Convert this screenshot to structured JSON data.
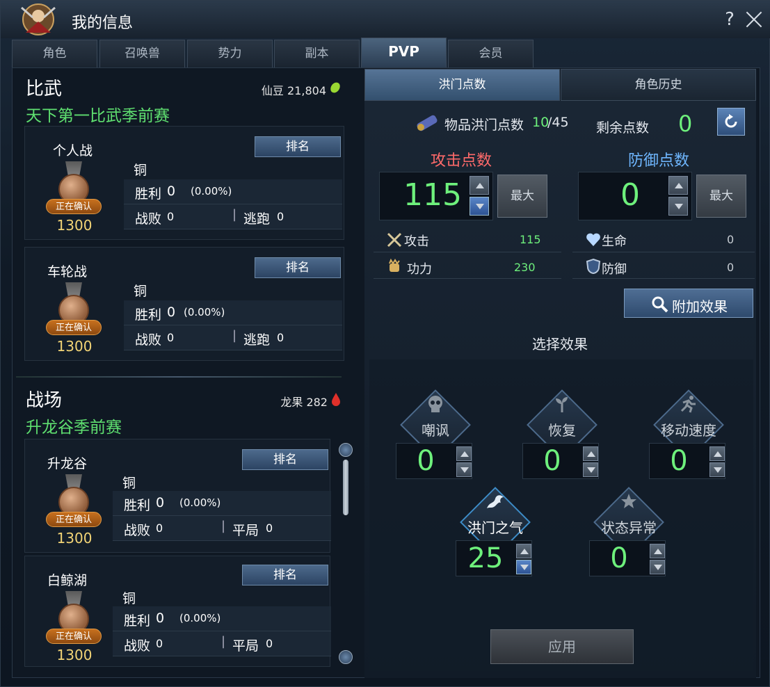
{
  "window": {
    "title": "我的信息",
    "help": "?"
  },
  "tabs": [
    "角色",
    "召唤兽",
    "势力",
    "副本",
    "PVP",
    "会员"
  ],
  "left": {
    "biwu": {
      "title": "比武",
      "season": "天下第一比武季前赛",
      "currency_label": "仙豆 21,804",
      "cards": [
        {
          "mode": "个人战",
          "rank_btn": "排名",
          "tier": "铜",
          "badge": "正在确认",
          "score": "1300",
          "win_label": "胜利",
          "win": "0",
          "win_pct": "(0.00%)",
          "lose_label": "战败",
          "lose": "0",
          "extra_label": "逃跑",
          "extra": "0"
        },
        {
          "mode": "车轮战",
          "rank_btn": "排名",
          "tier": "铜",
          "badge": "正在确认",
          "score": "1300",
          "win_label": "胜利",
          "win": "0",
          "win_pct": "(0.00%)",
          "lose_label": "战败",
          "lose": "0",
          "extra_label": "逃跑",
          "extra": "0"
        }
      ]
    },
    "battlefield": {
      "title": "战场",
      "season": "升龙谷季前赛",
      "currency_label": "龙果 282",
      "cards": [
        {
          "mode": "升龙谷",
          "rank_btn": "排名",
          "tier": "铜",
          "badge": "正在确认",
          "score": "1300",
          "win_label": "胜利",
          "win": "0",
          "win_pct": "(0.00%)",
          "lose_label": "战败",
          "lose": "0",
          "extra_label": "平局",
          "extra": "0"
        },
        {
          "mode": "白鲸湖",
          "rank_btn": "排名",
          "tier": "铜",
          "badge": "正在确认",
          "score": "1300",
          "win_label": "胜利",
          "win": "0",
          "win_pct": "(0.00%)",
          "lose_label": "战败",
          "lose": "0",
          "extra_label": "平局",
          "extra": "0"
        }
      ]
    }
  },
  "right": {
    "tabs": [
      "洪门点数",
      "角色历史"
    ],
    "item_points_label": "物品洪门点数",
    "item_points_cur": "10",
    "item_points_max": "/45",
    "remaining_label": "剩余点数",
    "remaining_value": "0",
    "attack_title": "攻击点数",
    "defense_title": "防御点数",
    "attack_value": "115",
    "defense_value": "0",
    "max_label": "最大",
    "stats": [
      {
        "icon": "swords-icon",
        "label": "攻击",
        "value": "115"
      },
      {
        "icon": "heart-icon",
        "label": "生命",
        "value": "0"
      },
      {
        "icon": "fist-icon",
        "label": "功力",
        "value": "230"
      },
      {
        "icon": "shield-icon",
        "label": "防御",
        "value": "0"
      }
    ],
    "add_effect": "附加效果",
    "select_effect": "选择效果",
    "effects": [
      {
        "name": "嘲讽",
        "value": "0",
        "icon": "skull-icon"
      },
      {
        "name": "恢复",
        "value": "0",
        "icon": "sprout-icon"
      },
      {
        "name": "移动速度",
        "value": "0",
        "icon": "runner-icon"
      },
      {
        "name": "洪门之气",
        "value": "25",
        "icon": "dragon-icon"
      },
      {
        "name": "状态异常",
        "value": "0",
        "icon": "star-icon"
      }
    ],
    "apply": "应用"
  },
  "colors": {
    "green": "#6ef07c",
    "season_green": "#5fe070",
    "attack_red": "#ff6a6a",
    "defense_blue": "#6fb7ff",
    "score_gold": "#f2d476"
  }
}
